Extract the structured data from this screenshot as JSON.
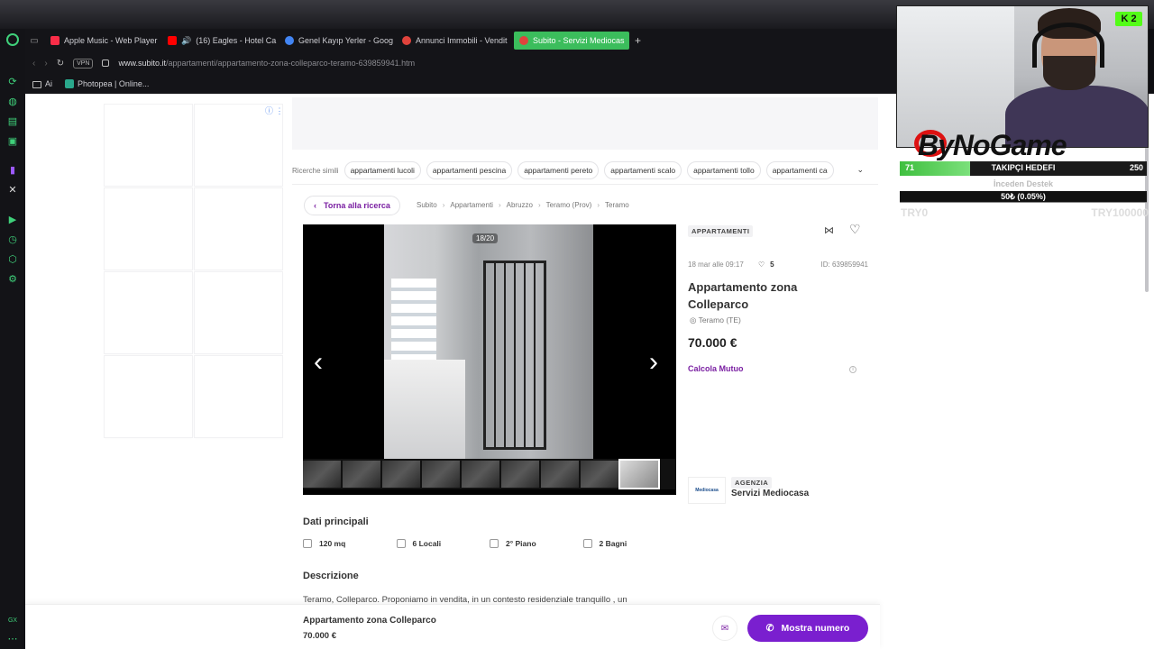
{
  "browser": {
    "tabs": [
      {
        "label": "Apple Music - Web Player",
        "color": "#fa2d48"
      },
      {
        "label": "(16) Eagles - Hotel Ca",
        "color": "#ff0000"
      },
      {
        "label": "Genel Kayıp Yerler - Goog",
        "color": "#4285f4"
      },
      {
        "label": "Annunci Immobili - Vendit",
        "color": "#e0433c"
      },
      {
        "label": "Subito - Servizi Mediocas",
        "color": "#e0433c",
        "active": true
      }
    ],
    "new_tab": "+",
    "vpn": "VPN",
    "url_domain": "www.subito.it",
    "url_path": "/appartamenti/appartamento-zona-colleparco-teramo-639859941.htm",
    "bookmarks": [
      {
        "label": "Ai",
        "icon": "folder-icon"
      },
      {
        "label": "Photopea | Online...",
        "icon": "photopea-icon"
      }
    ]
  },
  "related": {
    "label": "Ricerche simili",
    "chips": [
      "appartamenti lucoli",
      "appartamenti pescina",
      "appartamenti pereto",
      "appartamenti scalo",
      "appartamenti tollo",
      "appartamenti ca"
    ]
  },
  "back_label": "Torna alla ricerca",
  "breadcrumbs": [
    "Subito",
    "Appartamenti",
    "Abruzzo",
    "Teramo (Prov)",
    "Teramo"
  ],
  "gallery": {
    "counter": "18/20",
    "current": 18,
    "total": 20
  },
  "listing": {
    "category": "APPARTAMENTI",
    "date": "18 mar alle 09:17",
    "favorites": "5",
    "id": "ID: 639859941",
    "title": "Appartamento zona Colleparco",
    "location": "Teramo (TE)",
    "price": "70.000 €",
    "mortgage": "Calcola Mutuo"
  },
  "agency": {
    "tag": "AGENZIA",
    "name": "Servizi Mediocasa",
    "logo_text": "Mediocasa"
  },
  "dati": {
    "heading": "Dati principali",
    "features": [
      {
        "value": "120 mq",
        "icon": "area-icon"
      },
      {
        "value": "6 Locali",
        "icon": "rooms-icon"
      },
      {
        "value": "2° Piano",
        "icon": "floor-icon"
      },
      {
        "value": "2 Bagni",
        "icon": "bath-icon"
      }
    ]
  },
  "description": {
    "heading": "Descrizione",
    "text": "Teramo, Colleparco. Proponiamo in vendita, in un contesto residenziale tranquillo , un"
  },
  "sticky": {
    "title": "Appartamento zona Colleparco",
    "price": "70.000 €",
    "call_label": "Mostra numero"
  },
  "stream": {
    "brand": "ByNoGame",
    "goal_left": "71",
    "goal_label": "TAKIPÇI HEDEFI",
    "goal_right": "250",
    "goal_fraction": 0.284,
    "support_label": "İnceden Destek",
    "support_value": "50₺ (0.05%)",
    "try_min": "TRY0",
    "try_max": "TRY100000",
    "kick_badge": "2"
  }
}
